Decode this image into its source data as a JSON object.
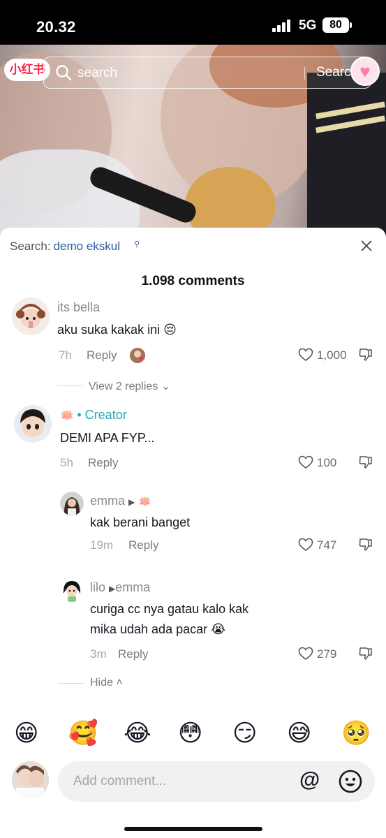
{
  "status_bar": {
    "time": "20.32",
    "network": "5G",
    "battery": "80"
  },
  "video": {
    "logo": "小红书",
    "search_placeholder": "search",
    "search_button": "Search"
  },
  "sheet": {
    "search_label": "Search:",
    "search_keyword": "demo ekskul",
    "comment_count": "1.098 comments",
    "comments": [
      {
        "name": "its bella",
        "text": "aku suka kakak ini 😔",
        "time": "7h",
        "reply": "Reply",
        "likes": "1,000",
        "view_replies": "View 2 replies"
      },
      {
        "badge_emoji": "🪷",
        "creator": "• Creator",
        "text": "DEMI APA FYP...",
        "time": "5h",
        "reply": "Reply",
        "likes": "100"
      },
      {
        "name": "emma",
        "reply_to_emoji": "🪷",
        "text": "kak berani banget",
        "time": "19m",
        "reply": "Reply",
        "likes": "747"
      },
      {
        "name": "lilo",
        "reply_to": "emma",
        "text_line1": "curiga cc nya gatau kalo kak",
        "text_line2": "mika udah ada pacar 😭",
        "time": "3m",
        "reply": "Reply",
        "likes": "279"
      }
    ],
    "hide_label": "Hide",
    "quick_emojis": [
      "😁",
      "🥰",
      "😂",
      "😳",
      "😏",
      "😅",
      "🥺"
    ],
    "input_placeholder": "Add comment...",
    "mention_symbol": "@"
  },
  "colors": {
    "creator": "#20a8b8",
    "keyword": "#2b5b9c",
    "logo_red": "#ff2442"
  }
}
